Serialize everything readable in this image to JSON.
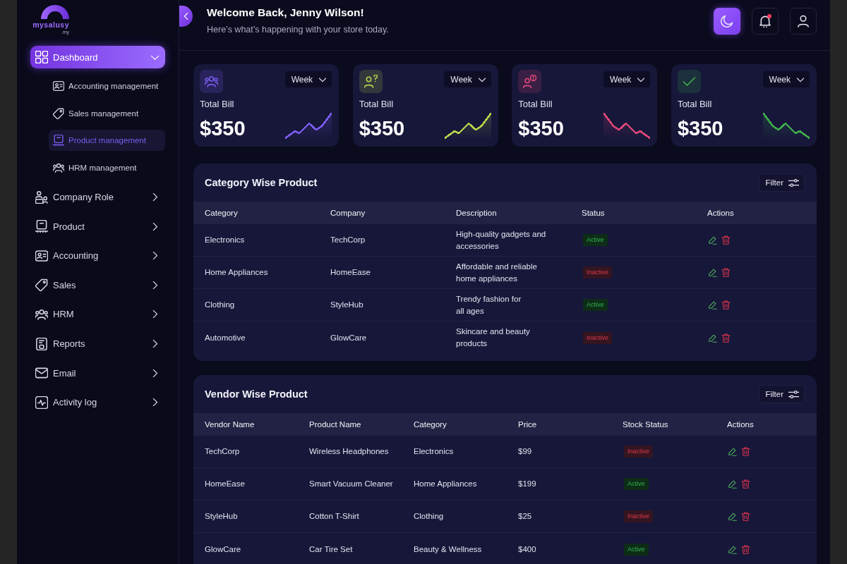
{
  "logo": {
    "name": "mysalusy",
    "domain": ".my"
  },
  "sidebar": {
    "items": [
      {
        "label": "Dashboard",
        "selected": true,
        "expanded": true,
        "children": [
          {
            "label": "Accounting management",
            "selected": false
          },
          {
            "label": "Sales management",
            "selected": false
          },
          {
            "label": "Product management",
            "selected": true
          },
          {
            "label": "HRM management",
            "selected": false
          }
        ]
      },
      {
        "label": "Company Role",
        "selected": false,
        "expanded": false
      },
      {
        "label": "Product",
        "selected": false,
        "expanded": false
      },
      {
        "label": "Accounting",
        "selected": false,
        "expanded": false
      },
      {
        "label": "Sales",
        "selected": false,
        "expanded": false
      },
      {
        "label": "HRM",
        "selected": false,
        "expanded": false
      },
      {
        "label": "Reports",
        "selected": false,
        "expanded": false
      },
      {
        "label": "Email",
        "selected": false,
        "expanded": false
      },
      {
        "label": "Activity log",
        "selected": false,
        "expanded": false
      }
    ]
  },
  "header": {
    "title": "Welcome Back, Jenny Wilson!",
    "subtitle": "Here’s what’s happening with your store today.",
    "dark_mode": true,
    "unread_notifications": true
  },
  "stats": [
    {
      "label": "Total Bill",
      "value": "$350",
      "period": "Week",
      "color": "#7b5cf0",
      "kind": "rising"
    },
    {
      "label": "Total Bill",
      "value": "$350",
      "period": "Week",
      "color": "#b5d34a",
      "kind": "rising"
    },
    {
      "label": "Total Bill",
      "value": "$350",
      "period": "Week",
      "color": "#e0487a",
      "kind": "falling"
    },
    {
      "label": "Total Bill",
      "value": "$350",
      "period": "Week",
      "color": "#3fae4a",
      "kind": "falling"
    }
  ],
  "category_table": {
    "title": "Category Wise Product",
    "filter_button": "Filter",
    "columns": [
      "Category",
      "Company",
      "Description",
      "Status",
      "Actions"
    ],
    "rows": [
      {
        "cells": [
          "Electronics",
          "TechCorp",
          "High-quality gadgets and\naccessories"
        ],
        "status": "Active",
        "active": true
      },
      {
        "cells": [
          "Home Appliances",
          "HomeEase",
          "Affordable and reliable\nhome appliances"
        ],
        "status": "Inactive",
        "active": false
      },
      {
        "cells": [
          "Clothing",
          "StyleHub",
          "Trendy fashion for\nall ages"
        ],
        "status": "Active",
        "active": true
      },
      {
        "cells": [
          "Automotive",
          "GlowCare",
          "Skincare and beauty\nproducts"
        ],
        "status": "Inactive",
        "active": false
      }
    ]
  },
  "vendor_table": {
    "title": "Vendor Wise Product",
    "filter_button": "Filter",
    "columns": [
      "Vendor Name",
      "Product Name",
      "Category",
      "Price",
      "Stock Status",
      "Actions"
    ],
    "rows": [
      {
        "cells": [
          "TechCorp",
          "Wireless Headphones",
          "Electronics",
          "$99"
        ],
        "status": "Inactive",
        "active": false
      },
      {
        "cells": [
          "HomeEase",
          "Smart Vacuum Cleaner",
          "Home Appliances",
          "$199"
        ],
        "status": "Active",
        "active": true
      },
      {
        "cells": [
          "StyleHub",
          "Cotton T-Shirt",
          "Clothing",
          "$25"
        ],
        "status": "Inactive",
        "active": false
      },
      {
        "cells": [
          "GlowCare",
          "Car Tire Set",
          "Beauty & Wellness",
          "$400"
        ],
        "status": "Active",
        "active": true
      }
    ]
  }
}
